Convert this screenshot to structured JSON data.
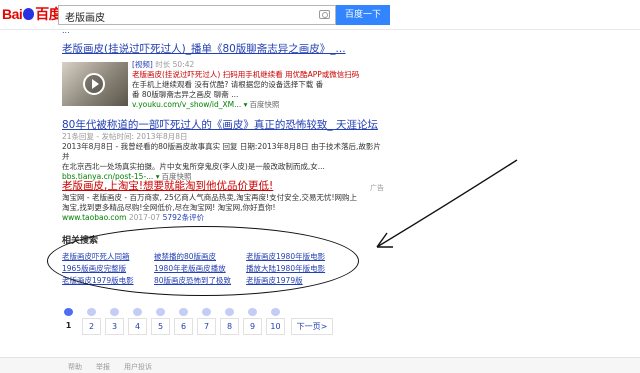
{
  "logo": {
    "latin_left": "Bai",
    "latin_right": "",
    "cn": "百度"
  },
  "search": {
    "value": "老版画皮",
    "button": "百度一下"
  },
  "topline": "...",
  "results": [
    {
      "title": "老版画皮(挂说过吓死过人)_播单《80版聊斋志异之画皮》_...",
      "tag": "[视频]",
      "duration": "时长 50:42",
      "abstract_1": "老版画皮(挂说过吓死过人) 扫码用手机继续看 用优酷APP或微信扫码",
      "abstract_2": "在手机上继续观看 没有优酷? 请根据您的设备选择下载 番",
      "abstract_3": "番 80版聊斋志异之画皮 聊斋 ...",
      "url": "v.youku.com/v_show/id_XM...",
      "snapshot": "百度快照"
    },
    {
      "title": "80年代被称道的一部吓死过人的《画皮》真正的恐怖较致_ 天涯论坛",
      "meta": "21条回复 - 发帖时间: 2013年8月8日",
      "abstract_1": "2013年8月8日 - 我曾经看的80版画皮故事真实 回复 日期:2013年8月8日 由于技术落后,故影片并",
      "abstract_2": "在北京西北一处场真实拍摄。片中女鬼所穿鬼皮(李人皮)是一般改政制而成,女...",
      "url": "bbs.tianya.cn/post-15-...",
      "snapshot": "百度快照"
    },
    {
      "title": "老版画皮,上淘宝!想要就能淘到他优品价更低!",
      "abstract_1": "淘宝网 - 老版画皮 - 百万商家, 25亿商人气商品热卖,淘宝再度!支付安全,交易无忧!网购上",
      "abstract_2": "淘宝,找到更多精品尽购!全网低价,尽在淘宝网! 淘宝网,你好直你!",
      "url": "www.taobao.com",
      "date": "2017-07",
      "rating": "5792条评价",
      "ad": "广告"
    }
  ],
  "related": {
    "title": "相关搜索",
    "items": [
      "老版画皮吓死人同箱",
      "被禁播的80版画皮",
      "老版画皮1980年版电影",
      "1965版画皮完整版",
      "1980年老版画皮播放",
      "播放大陆1980年版电影",
      "老版画皮1979版电影",
      "80版画皮恐怖到了极致",
      "老版画皮1979版"
    ]
  },
  "pager": {
    "pages": [
      "1",
      "2",
      "3",
      "4",
      "5",
      "6",
      "7",
      "8",
      "9",
      "10"
    ],
    "current": "1",
    "next": "下一页>"
  },
  "footer": {
    "links": [
      "帮助",
      "举报",
      "用户投诉"
    ]
  },
  "colors": {
    "link": "#2440b3",
    "highlight": "#c00",
    "url": "#008000",
    "brand_blue": "#3385ff",
    "brand_red": "#e10602"
  }
}
